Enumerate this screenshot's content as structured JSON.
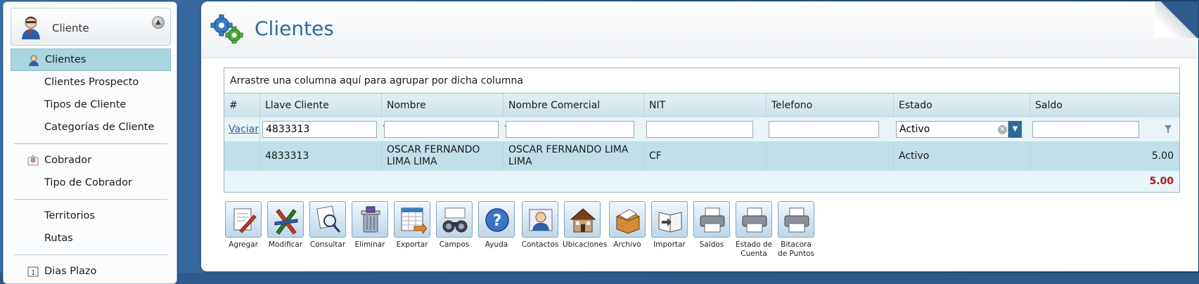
{
  "sidebar": {
    "header_title": "Cliente",
    "items": [
      {
        "label": "Clientes"
      },
      {
        "label": "Clientes Prospecto"
      },
      {
        "label": "Tipos de Cliente"
      },
      {
        "label": "Categorías de Cliente"
      },
      {
        "label": "Cobrador"
      },
      {
        "label": "Tipo de Cobrador"
      },
      {
        "label": "Territorios"
      },
      {
        "label": "Rutas"
      },
      {
        "label": "Dias Plazo"
      }
    ]
  },
  "main": {
    "title": "Clientes"
  },
  "grid": {
    "group_hint": "Arrastre una columna aquí para agrupar por dicha columna",
    "columns": [
      "#",
      "Llave Cliente",
      "Nombre",
      "Nombre Comercial",
      "NIT",
      "Telefono",
      "Estado",
      "Saldo"
    ],
    "filter": {
      "clear_label": "Vaciar",
      "llave_cliente": "4833313",
      "nombre": "",
      "nombre_comercial": "",
      "nit": "",
      "telefono": "",
      "estado": "Activo",
      "saldo": ""
    },
    "rows": [
      {
        "num": "",
        "llave_cliente": "4833313",
        "nombre": "OSCAR FERNANDO LIMA LIMA",
        "nombre_comercial": "OSCAR FERNANDO LIMA LIMA",
        "nit": "CF",
        "telefono": "",
        "estado": "Activo",
        "saldo": "5.00"
      }
    ],
    "total_saldo": "5.00"
  },
  "toolbar": {
    "buttons": [
      {
        "label": "Agregar",
        "icon": "add-document-icon"
      },
      {
        "label": "Modificar",
        "icon": "edit-pencils-icon"
      },
      {
        "label": "Consultar",
        "icon": "magnifier-document-icon"
      },
      {
        "label": "Eliminar",
        "icon": "trash-icon"
      },
      {
        "label": "Exportar",
        "icon": "export-spreadsheet-icon"
      },
      {
        "label": "Campos",
        "icon": "binoculars-icon"
      },
      {
        "label": "Ayuda",
        "icon": "help-icon"
      },
      {
        "label": "Contactos",
        "icon": "contacts-icon"
      },
      {
        "label": "Ubicaciones",
        "icon": "house-icon"
      },
      {
        "label": "Archivo",
        "icon": "file-box-icon"
      },
      {
        "label": "Importar",
        "icon": "import-book-icon"
      },
      {
        "label": "Saldos",
        "icon": "printer-icon"
      },
      {
        "label": "Estado de Cuenta",
        "icon": "printer-icon"
      },
      {
        "label": "Bitacora de Puntos",
        "icon": "printer-icon"
      }
    ]
  },
  "colors": {
    "accent": "#2e6d9e",
    "selected_row": "#bfe0e8",
    "total": "#a02020"
  }
}
